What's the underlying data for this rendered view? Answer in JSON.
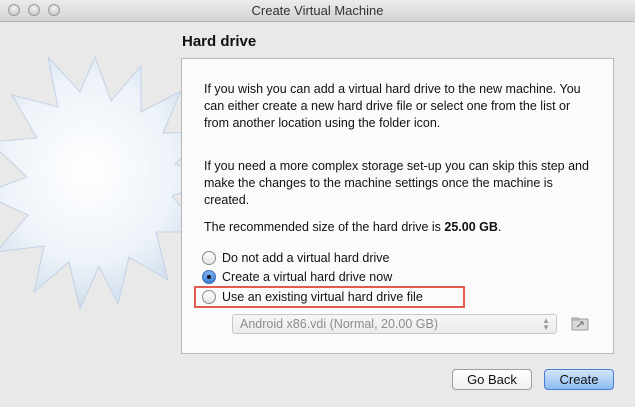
{
  "window": {
    "title": "Create Virtual Machine"
  },
  "page": {
    "heading": "Hard drive",
    "paragraph1": "If you wish you can add a virtual hard drive to the new machine. You can either create a new hard drive file or select one from the list or from another location using the folder icon.",
    "paragraph2": "If you need a more complex storage set-up you can skip this step and make the changes to the machine settings once the machine is created.",
    "recommended_prefix": "The recommended size of the hard drive is ",
    "recommended_size": "25.00 GB",
    "recommended_suffix": "."
  },
  "options": [
    {
      "label": "Do not add a virtual hard drive",
      "selected": false
    },
    {
      "label": "Create a virtual hard drive now",
      "selected": true
    },
    {
      "label": "Use an existing virtual hard drive file",
      "selected": false
    }
  ],
  "disk_select": {
    "value": "Android x86.vdi (Normal, 20.00 GB)",
    "enabled": false
  },
  "buttons": {
    "back": "Go Back",
    "create": "Create"
  },
  "colors": {
    "highlight": "#e35a4f",
    "primary_button": "#8dbcf2"
  }
}
